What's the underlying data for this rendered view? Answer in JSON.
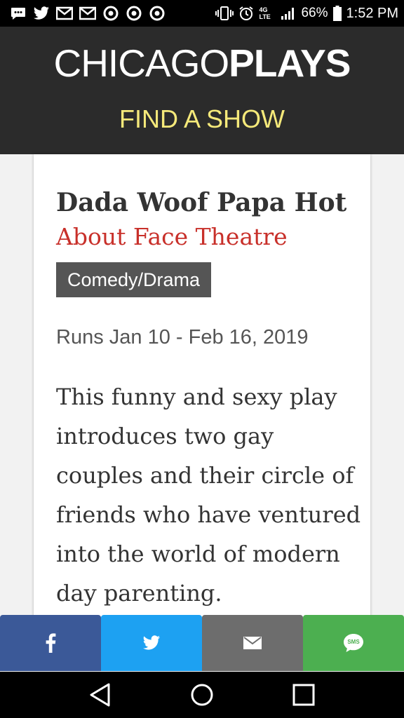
{
  "status_bar": {
    "notification_icons": [
      "message-icon",
      "twitter-icon",
      "gmail-icon",
      "gmail-icon",
      "chrome-icon",
      "chrome-icon",
      "chrome-icon"
    ],
    "network": "4G LTE",
    "battery": "66%",
    "time": "1:52 PM"
  },
  "header": {
    "logo_light": "CHICAGO",
    "logo_bold": "PLAYS",
    "find_show": "FIND A SHOW"
  },
  "show": {
    "title": "Dada Woof Papa Hot",
    "theatre": "About Face Theatre",
    "genre": "Comedy/Drama",
    "runs": "Runs Jan 10 - Feb 16, 2019",
    "description": "This funny and sexy play introduces two gay couples and their circle of friends who have ventured into the world of modern day parenting."
  },
  "share": {
    "facebook": {
      "icon": "facebook-icon",
      "color": "#3b5998"
    },
    "twitter": {
      "icon": "twitter-icon",
      "color": "#1da1f2"
    },
    "email": {
      "icon": "email-icon",
      "color": "#6d6d6d"
    },
    "sms": {
      "icon": "sms-icon",
      "label": "SMS",
      "color": "#4caf50"
    }
  },
  "colors": {
    "header_bg": "#2b2b2b",
    "find_show": "#f5e97a",
    "theatre": "#c8302a",
    "genre_bg": "#555555"
  }
}
